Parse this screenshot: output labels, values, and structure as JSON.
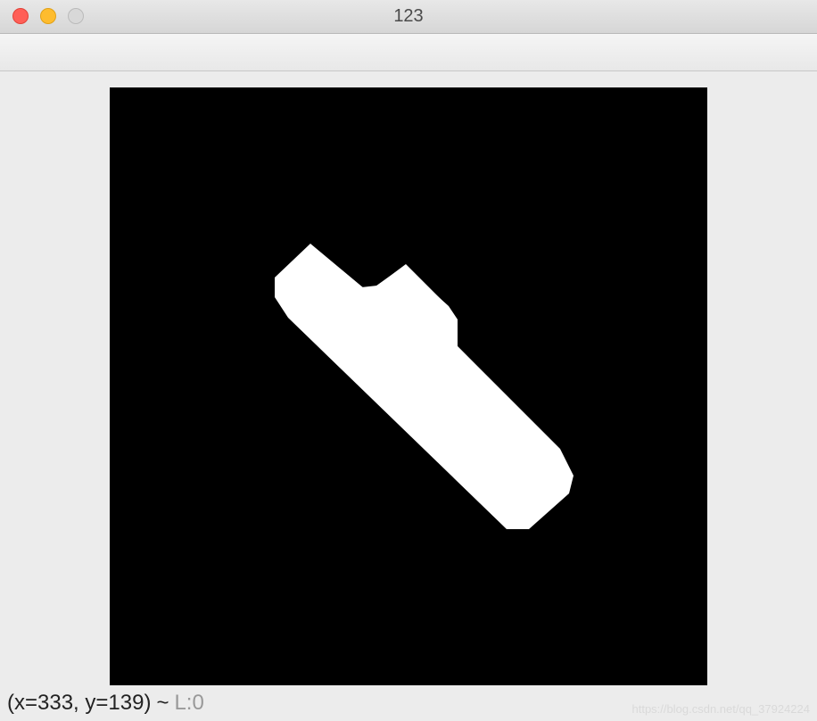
{
  "window": {
    "title": "123"
  },
  "status": {
    "coords": "(x=333, y=139)",
    "separator": "~",
    "value": "L:0"
  },
  "watermark": "https://blog.csdn.net/qq_37924224"
}
